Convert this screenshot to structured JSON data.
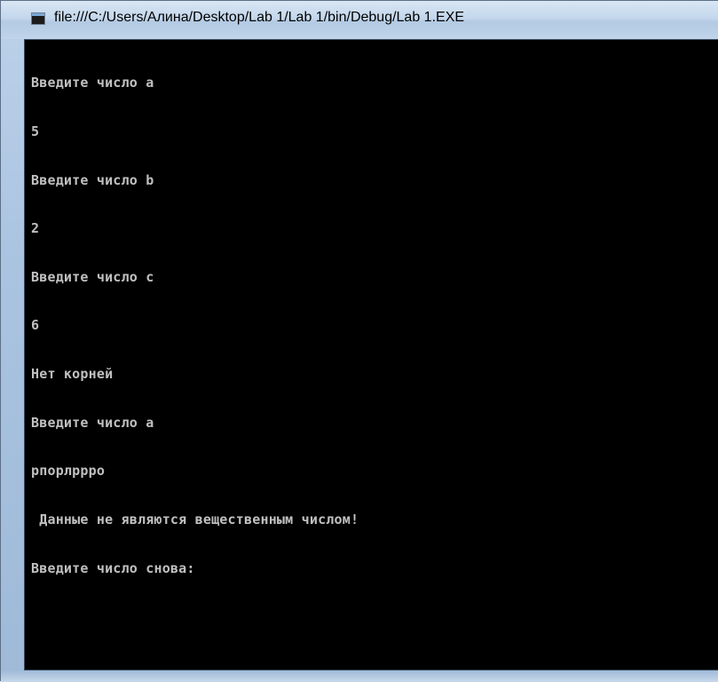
{
  "window": {
    "title": "file:///C:/Users/Алина/Desktop/Lab 1/Lab 1/bin/Debug/Lab 1.EXE",
    "icon": "console-app-icon"
  },
  "console": {
    "lines": [
      "Введите число a",
      "5",
      "Введите число b",
      "2",
      "Введите число c",
      "6",
      "Нет корней",
      "Введите число a",
      "рпорлрppо",
      " Данные не являются вещественным числом!",
      "Введите число снова:"
    ]
  }
}
